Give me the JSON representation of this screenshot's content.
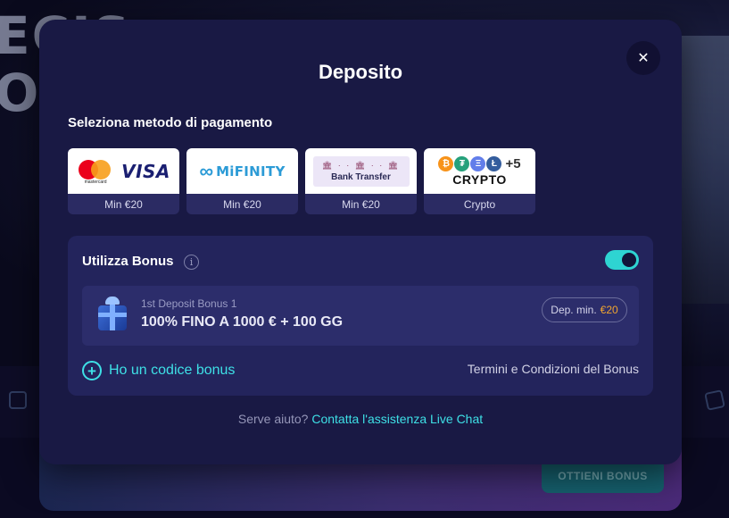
{
  "background": {
    "hero_text_line1": "ECIS",
    "hero_text_line2": "O",
    "banner_button": "OTTIENI BONUS"
  },
  "modal": {
    "title": "Deposito",
    "close_symbol": "✕",
    "section_label": "Seleziona metodo di pagamento",
    "methods": [
      {
        "id": "card",
        "logo_primary": "VISA",
        "logo_secondary": "mastercard",
        "caption": "Min €20"
      },
      {
        "id": "mifinity",
        "logo_primary": "MiFINITY",
        "logo_icon": "∞",
        "caption": "Min €20"
      },
      {
        "id": "bank",
        "logo_primary": "Bank Transfer",
        "caption": "Min €20"
      },
      {
        "id": "crypto",
        "logo_primary": "CRYPTO",
        "logo_extra": "+5",
        "caption": "Crypto",
        "coins": [
          {
            "symbol": "₿",
            "color": "#f7931a"
          },
          {
            "symbol": "₮",
            "color": "#26a17b"
          },
          {
            "symbol": "Ξ",
            "color": "#627eea"
          },
          {
            "symbol": "Ł",
            "color": "#345d9d"
          }
        ]
      }
    ],
    "bonus": {
      "label": "Utilizza Bonus",
      "info_symbol": "i",
      "toggle_on": true,
      "toggle_color": "#2ed4d2",
      "card": {
        "subtitle": "1st Deposit Bonus 1",
        "title": "100% FINO A 1000 € + 100 GG",
        "badge_label": "Dep. min.",
        "badge_amount": "€20"
      },
      "code_link": "Ho un codice bonus",
      "terms_link": "Termini e Condizioni del Bonus"
    },
    "help": {
      "text": "Serve aiuto?",
      "link": "Contatta l'assistenza Live Chat"
    }
  }
}
